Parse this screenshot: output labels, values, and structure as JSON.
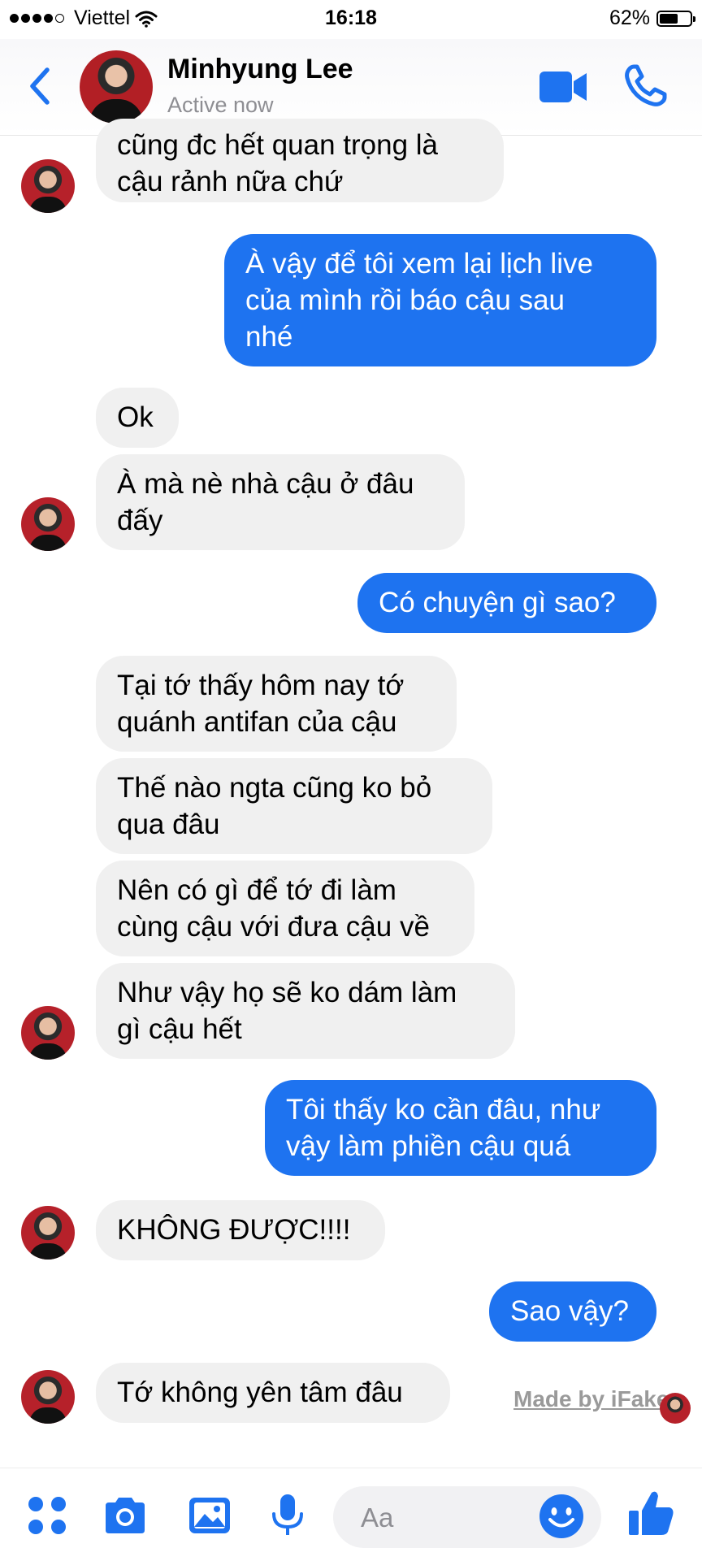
{
  "status_bar": {
    "carrier": "Viettel",
    "time": "16:18",
    "battery_text": "62%",
    "battery_level": 0.62
  },
  "header": {
    "name": "Minhyung Lee",
    "status": "Active now",
    "accent_color": "#1e73f0"
  },
  "messages": [
    {
      "side": "in",
      "text": "cũng đc hết quan trọng là\ncậu rảnh nữa chứ"
    },
    {
      "side": "out",
      "text": "À vậy để tôi xem lại lịch live\ncủa mình rồi báo cậu sau\nnhé"
    },
    {
      "side": "in",
      "text": "Ok"
    },
    {
      "side": "in",
      "text": "À mà nè nhà cậu ở đâu\nđấy"
    },
    {
      "side": "out",
      "text": "Có chuyện gì sao?"
    },
    {
      "side": "in",
      "text": "Tại tớ thấy hôm nay tớ\nquánh antifan của cậu"
    },
    {
      "side": "in",
      "text": "Thế nào ngta cũng ko bỏ\nqua đâu"
    },
    {
      "side": "in",
      "text": "Nên có gì để tớ đi làm\ncùng cậu với đưa cậu về"
    },
    {
      "side": "in",
      "text": "Như vậy họ sẽ ko dám làm\ngì cậu hết"
    },
    {
      "side": "out",
      "text": "Tôi thấy ko cần đâu, như\nvậy làm phiền cậu quá"
    },
    {
      "side": "in",
      "text": "KHÔNG ĐƯỢC!!!!"
    },
    {
      "side": "out",
      "text": "Sao vậy?"
    },
    {
      "side": "in",
      "text": "Tớ không yên tâm đâu"
    }
  ],
  "watermark": "Made by iFake",
  "composer": {
    "placeholder": "Aa",
    "icons": [
      "menu-icon",
      "camera-icon",
      "gallery-icon",
      "microphone-icon",
      "emoji-icon",
      "like-icon"
    ]
  }
}
